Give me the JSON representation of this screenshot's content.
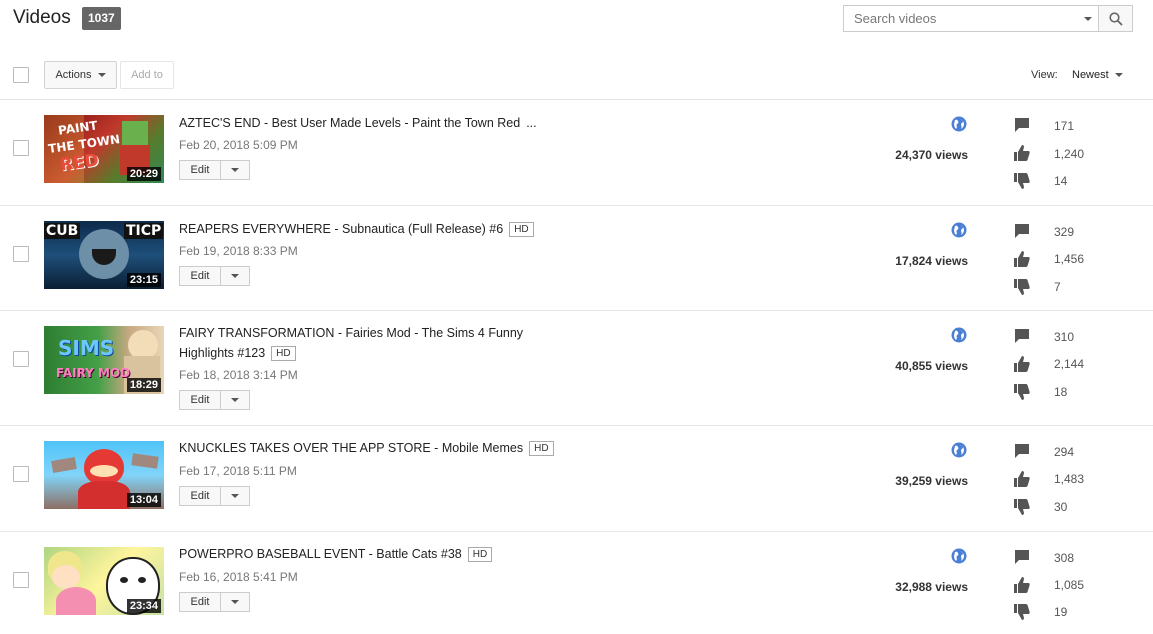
{
  "header": {
    "title": "Videos",
    "count": "1037",
    "search_placeholder": "Search videos"
  },
  "toolbar": {
    "actions_label": "Actions",
    "add_to_label": "Add to",
    "view_label": "View:",
    "view_value": "Newest"
  },
  "videos": [
    {
      "title": "AZTEC'S END - Best User Made Levels - Paint the Town Red",
      "title_suffix": "...",
      "hd": "",
      "date": "Feb 20, 2018 5:09 PM",
      "duration": "20:29",
      "views": "24,370 views",
      "comments": "171",
      "likes": "1,240",
      "dislikes": "14",
      "thumb_text": [
        "PAINT",
        "THE TOWN",
        "RED"
      ]
    },
    {
      "title": "REAPERS EVERYWHERE - Subnautica (Full Release) #6",
      "title_suffix": "",
      "hd": "HD",
      "date": "Feb 19, 2018 8:33 PM",
      "duration": "23:15",
      "views": "17,824 views",
      "comments": "329",
      "likes": "1,456",
      "dislikes": "7",
      "thumb_text": [
        "CUB",
        "TICP"
      ]
    },
    {
      "title": "FAIRY TRANSFORMATION - Fairies Mod - The Sims 4 Funny Highlights #123",
      "title_suffix": "",
      "hd": "HD",
      "date": "Feb 18, 2018 3:14 PM",
      "duration": "18:29",
      "views": "40,855 views",
      "comments": "310",
      "likes": "2,144",
      "dislikes": "18",
      "thumb_text": [
        "SIMS",
        "FAIRY MOD"
      ]
    },
    {
      "title": "KNUCKLES TAKES OVER THE APP STORE - Mobile Memes",
      "title_suffix": "",
      "hd": "HD",
      "date": "Feb 17, 2018 5:11 PM",
      "duration": "13:04",
      "views": "39,259 views",
      "comments": "294",
      "likes": "1,483",
      "dislikes": "30",
      "thumb_text": []
    },
    {
      "title": "POWERPRO BASEBALL EVENT - Battle Cats #38",
      "title_suffix": "",
      "hd": "HD",
      "date": "Feb 16, 2018 5:41 PM",
      "duration": "23:34",
      "views": "32,988 views",
      "comments": "308",
      "likes": "1,085",
      "dislikes": "19",
      "thumb_text": []
    }
  ],
  "edit_label": "Edit",
  "icons": {
    "search": "search-icon",
    "globe": "globe-icon",
    "comment": "comment-icon",
    "like": "thumbs-up-icon",
    "dislike": "thumbs-down-icon"
  },
  "colors": {
    "badge": "#666666",
    "icon": "#555555",
    "globe": "#4a7fd4"
  }
}
